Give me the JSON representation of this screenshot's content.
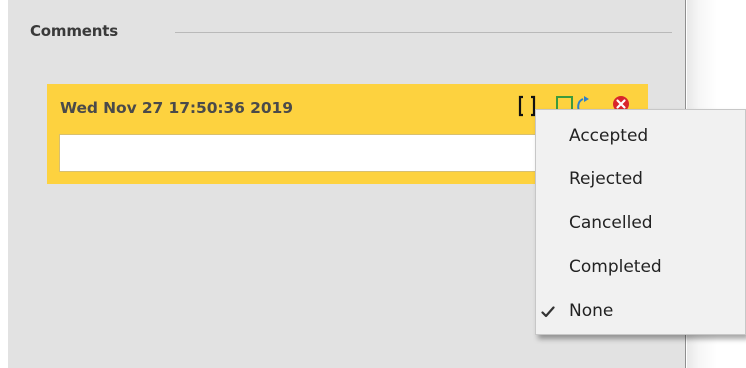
{
  "section": {
    "title": "Comments"
  },
  "comment": {
    "date": "Wed Nov 27 17:50:36 2019",
    "text_value": "",
    "icons": {
      "brackets": "brackets-icon",
      "square": "checkbox-icon",
      "refresh": "refresh-icon",
      "delete": "delete-icon"
    }
  },
  "status_menu": {
    "items": [
      {
        "label": "Accepted",
        "checked": false
      },
      {
        "label": "Rejected",
        "checked": false
      },
      {
        "label": "Cancelled",
        "checked": false
      },
      {
        "label": "Completed",
        "checked": false
      },
      {
        "label": "None",
        "checked": true
      }
    ],
    "check_glyph": "✔"
  },
  "colors": {
    "panel_bg": "#e2e2e2",
    "card_bg": "#fdd23f",
    "menu_bg": "#f1f1f1",
    "text": "#222222",
    "delete_red": "#d9262b",
    "icon_green": "#3c9a3c",
    "icon_blue": "#2f80c8"
  }
}
